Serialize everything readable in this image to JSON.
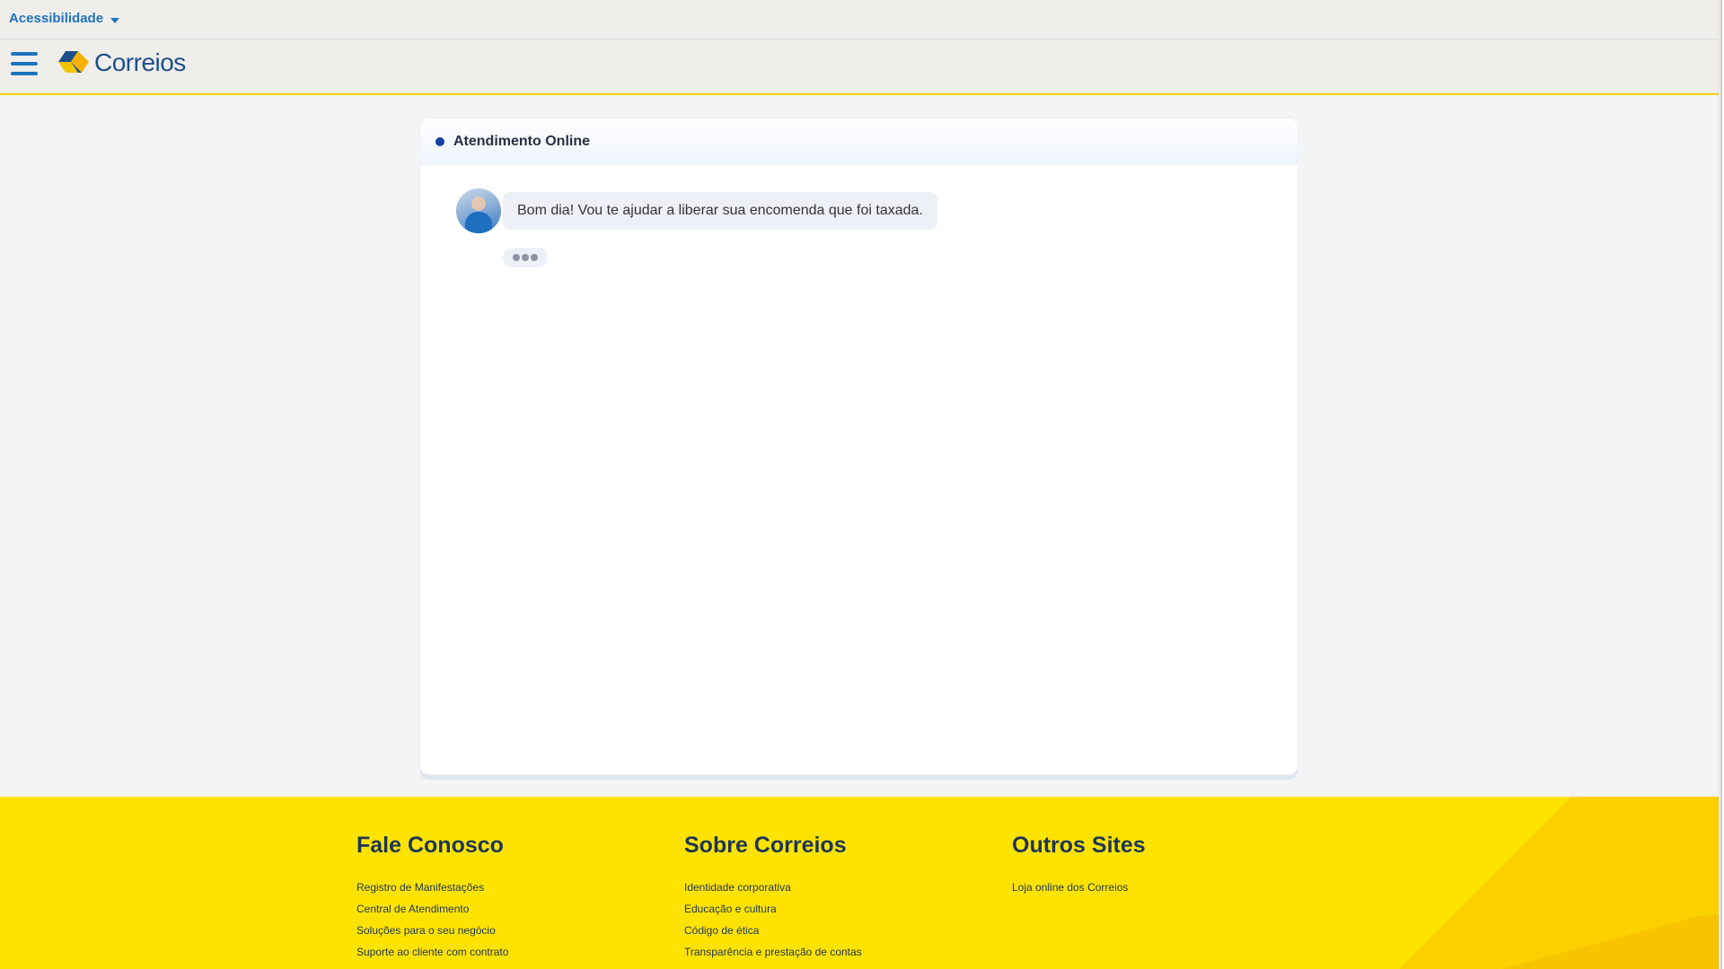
{
  "accessibility": {
    "label": "Acessibilidade"
  },
  "header": {
    "logo_text": "Correios"
  },
  "chat": {
    "title": "Atendimento Online",
    "messages": [
      {
        "text": "Bom dia! Vou te ajudar a liberar sua encomenda que foi taxada."
      }
    ]
  },
  "footer": {
    "columns": [
      {
        "title": "Fale Conosco",
        "links": [
          "Registro de Manifestações",
          "Central de Atendimento",
          "Soluções para o seu negócio",
          "Suporte ao cliente com contrato"
        ]
      },
      {
        "title": "Sobre Correios",
        "links": [
          "Identidade corporativa",
          "Educação e cultura",
          "Código de ética",
          "Transparência e prestação de contas"
        ]
      },
      {
        "title": "Outros Sites",
        "links": [
          "Loja online dos Correios"
        ]
      }
    ]
  },
  "colors": {
    "brand_blue": "#1e73be",
    "brand_yellow": "#ffe300",
    "logo_blue": "#1d4f8a"
  }
}
